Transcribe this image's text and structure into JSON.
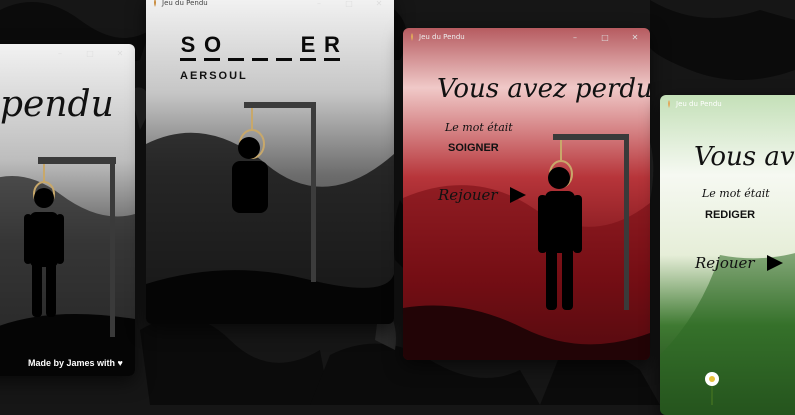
{
  "window_title": "Jeu du Pendu",
  "controls": {
    "minimize": "–",
    "maximize": "□",
    "close": "✕"
  },
  "left_window": {
    "heading_fragment": "pendu",
    "credit": "Made by James with"
  },
  "game_window": {
    "slots": [
      "S",
      "O",
      "",
      "",
      "",
      "E",
      "R"
    ],
    "guessed_letters": "AERSOUL"
  },
  "lost_window_1": {
    "heading": "Vous avez perdu",
    "word_label": "Le mot était",
    "word": "SOIGNER",
    "replay": "Rejouer"
  },
  "lost_window_2": {
    "heading": "Vous avez",
    "word_label": "Le mot était",
    "word": "REDIGER",
    "replay": "Rejouer"
  },
  "colors": {
    "red_theme": "#8a1a1e",
    "green_theme": "#2f5a25",
    "gray_theme": "#9a9a9a"
  }
}
